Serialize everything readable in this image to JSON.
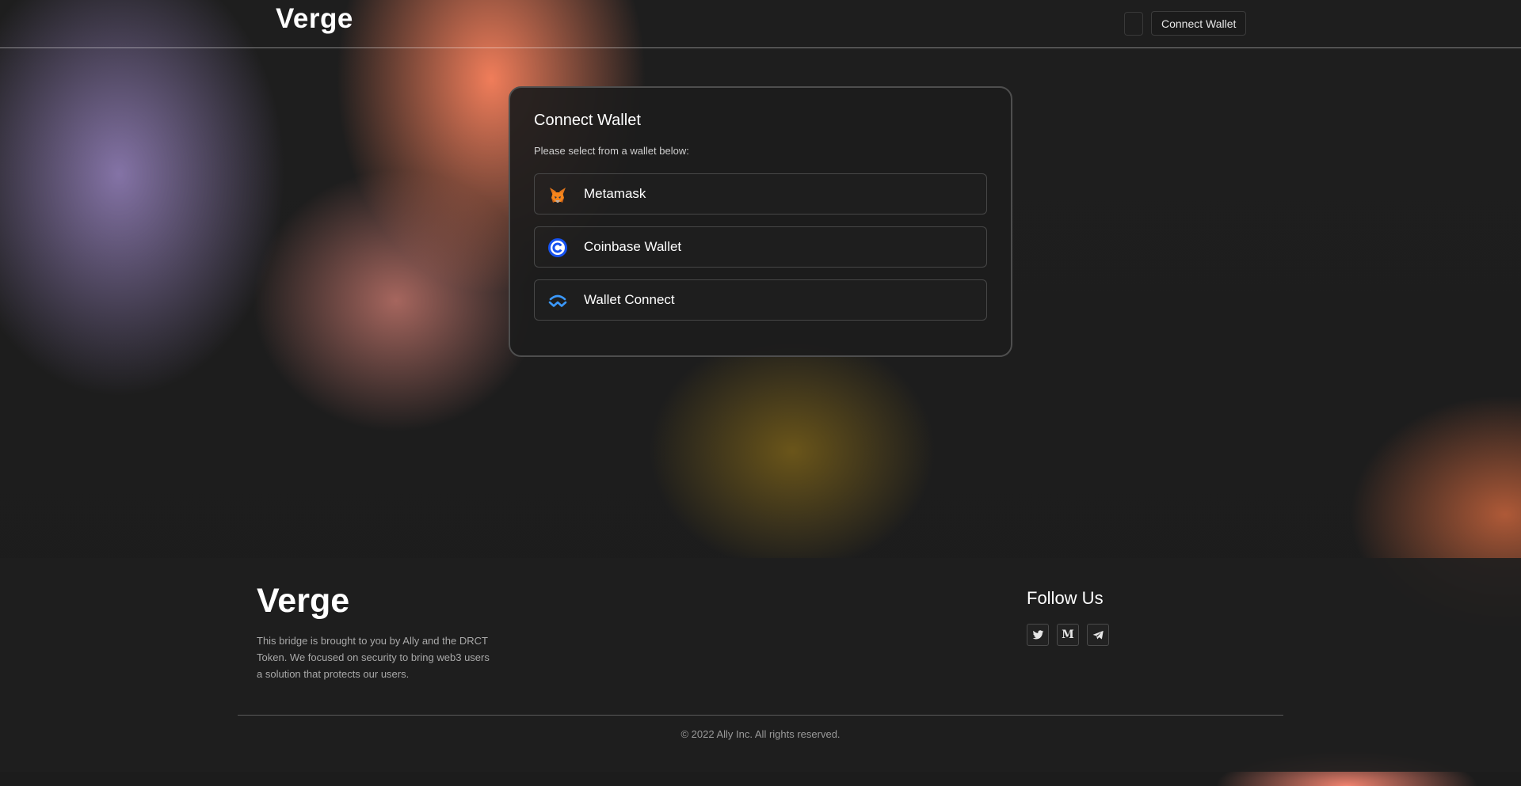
{
  "header": {
    "logo": "Verge",
    "connect_label": "Connect Wallet"
  },
  "modal": {
    "title": "Connect Wallet",
    "subtitle": "Please select from a wallet below:",
    "wallets": [
      {
        "label": "Metamask",
        "icon": "metamask-fox-icon"
      },
      {
        "label": "Coinbase Wallet",
        "icon": "coinbase-icon"
      },
      {
        "label": "Wallet Connect",
        "icon": "walletconnect-icon"
      }
    ]
  },
  "footer": {
    "logo": "Verge",
    "description": "This bridge is brought to you by Ally and the DRCT Token. We focused on security to bring web3 users a solution that protects our users.",
    "follow_title": "Follow Us",
    "socials": [
      {
        "name": "twitter",
        "icon": "twitter-icon"
      },
      {
        "name": "medium",
        "icon": "medium-icon",
        "glyph": "M"
      },
      {
        "name": "telegram",
        "icon": "telegram-icon"
      }
    ],
    "copyright": "© 2022 Ally Inc. All rights reserved."
  },
  "colors": {
    "background": "#1d1d1d",
    "modal_bg": "#1c1c1c",
    "modal_border": "#4e4e4e",
    "text": "#ffffff",
    "muted": "#a9a9a9",
    "coinbase_blue": "#1652f0",
    "walletconnect_blue": "#3b99fc",
    "metamask_orange": "#e2761b"
  }
}
